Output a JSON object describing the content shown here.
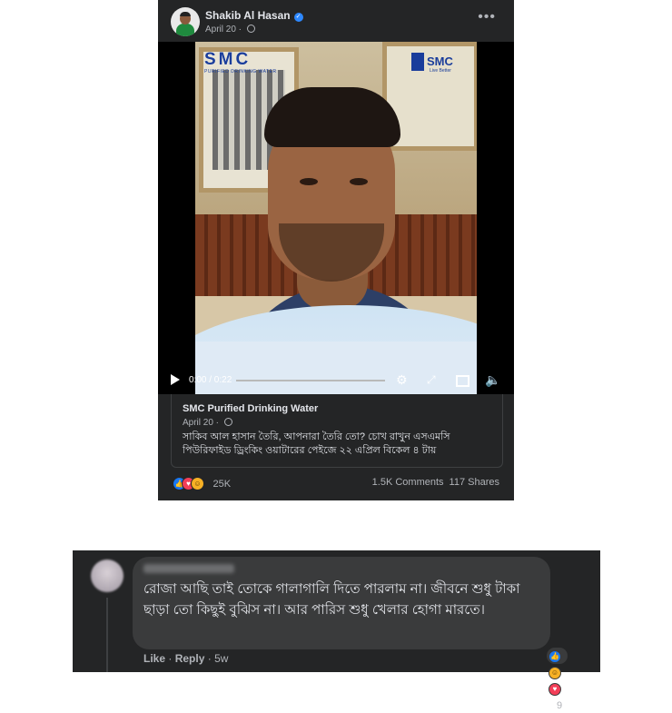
{
  "post": {
    "author": "Shakib Al Hasan",
    "date": "April 20 · ",
    "more_label": "•••"
  },
  "video": {
    "logo_left": "SMC",
    "logo_left_sub": "PURIFIED DRINKING WATER",
    "logo_right": "SMC",
    "logo_right_tag": "Live Better",
    "time": "0:00 / 0:22"
  },
  "shared": {
    "name": "SMC Purified Drinking Water",
    "date": "April 20 · ",
    "text": "সাকিব আল হাসান তৈরি, আপনারা তৈরি তো? চোখ রাখুন এসএমসি পিউরিফাইড ড্রিংকিং ওয়াটারের পেইজে ২২ এপ্রিল বিকেল ৪ টায়"
  },
  "reactions": {
    "count": "25K",
    "comments": "1.5K Comments",
    "shares": "117 Shares"
  },
  "comment": {
    "text": "রোজা আছি তাই তোকে গালাগালি দিতে পারলাম না। জীবনে শুধু টাকা ছাড়া তো কিছুই বুঝিস না। আর পারিস শুধু খেলার হোগা মারতে।",
    "reaction_count": "9",
    "like_label": "Like",
    "reply_label": "Reply",
    "age": "5w"
  }
}
